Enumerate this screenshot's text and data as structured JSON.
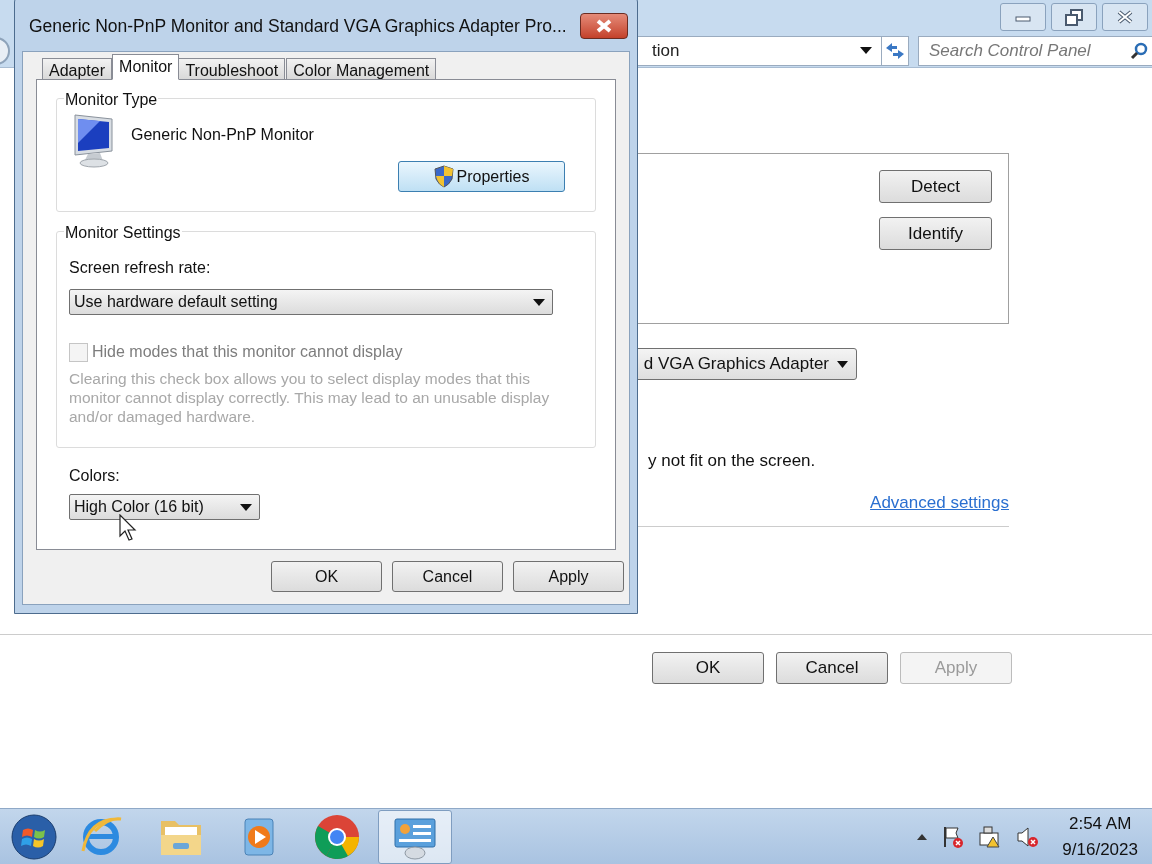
{
  "background_window": {
    "address_text": "tion",
    "search": {
      "placeholder": "Search Control Panel"
    },
    "panel_buttons": [
      "Detect",
      "Identify"
    ],
    "adapter_dropdown": "d VGA Graphics Adapter",
    "note": "y not fit on the screen.",
    "link": "Advanced settings",
    "buttons": [
      {
        "label": "OK",
        "disabled": false
      },
      {
        "label": "Cancel",
        "disabled": false
      },
      {
        "label": "Apply",
        "disabled": true
      }
    ]
  },
  "dialog": {
    "title": "Generic Non-PnP Monitor and Standard VGA Graphics Adapter Pro...",
    "tabs": [
      {
        "label": "Adapter",
        "selected": false
      },
      {
        "label": "Monitor",
        "selected": true
      },
      {
        "label": "Troubleshoot",
        "selected": false
      },
      {
        "label": "Color Management",
        "selected": false
      }
    ],
    "monitor_type": {
      "legend": "Monitor Type",
      "name": "Generic Non-PnP Monitor",
      "button": "Properties"
    },
    "monitor_settings": {
      "legend": "Monitor Settings",
      "refresh_label": "Screen refresh rate:",
      "refresh_value": "Use hardware default setting",
      "checkbox": {
        "label": "Hide modes that this monitor cannot display",
        "checked": false,
        "disabled": true
      },
      "help": "Clearing this check box allows you to select display modes that this monitor cannot display correctly. This may lead to an unusable display and/or damaged hardware."
    },
    "colors": {
      "label": "Colors:",
      "value": "High Color (16 bit)"
    },
    "buttons": [
      "OK",
      "Cancel",
      "Apply"
    ]
  },
  "taskbar": {
    "apps": [
      {
        "kind": "start",
        "selected": false
      },
      {
        "kind": "browser-e",
        "selected": false
      },
      {
        "kind": "folder",
        "selected": false
      },
      {
        "kind": "player",
        "selected": false
      },
      {
        "kind": "chrome",
        "selected": false
      },
      {
        "kind": "control-panel",
        "selected": true
      }
    ],
    "clock": {
      "time": "2:54 AM",
      "date": "9/16/2023"
    }
  }
}
